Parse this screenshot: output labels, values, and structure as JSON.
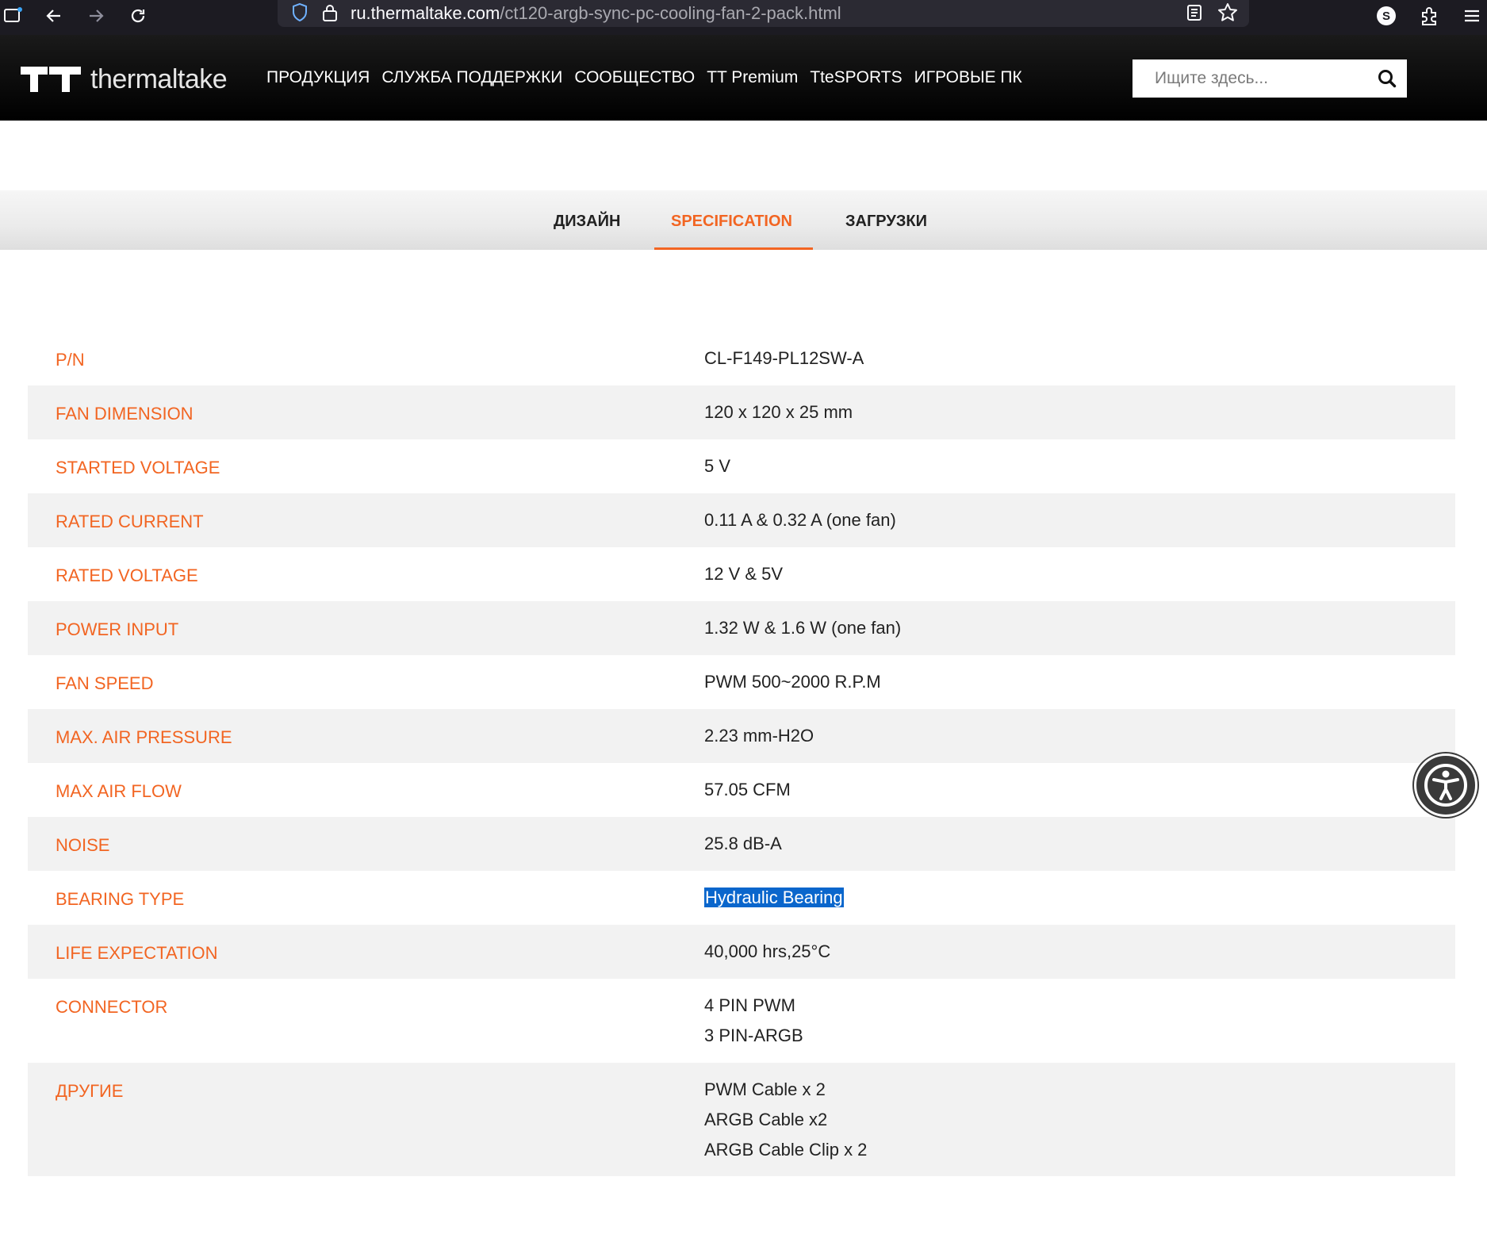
{
  "browser": {
    "url_domain": "ru.thermaltake.com",
    "url_path": "/ct120-argb-sync-pc-cooling-fan-2-pack.html",
    "profile_initial": "S"
  },
  "header": {
    "logo_text": "thermaltake",
    "nav": [
      "ПРОДУКЦИЯ",
      "СЛУЖБА ПОДДЕРЖКИ",
      "СООБЩЕСТВО",
      "TT Premium",
      "TteSPORTS",
      "ИГРОВЫЕ ПК"
    ],
    "search_placeholder": "Ищите здесь..."
  },
  "tabs": {
    "items": [
      "ДИЗАЙН",
      "SPECIFICATION",
      "ЗАГРУЗКИ"
    ],
    "active": "SPECIFICATION"
  },
  "specs": [
    {
      "label": "P/N",
      "values": [
        "CL-F149-PL12SW-A"
      ]
    },
    {
      "label": "FAN DIMENSION",
      "values": [
        "120 x 120 x 25 mm"
      ]
    },
    {
      "label": "STARTED VOLTAGE",
      "values": [
        "5 V"
      ]
    },
    {
      "label": "RATED CURRENT",
      "values": [
        "0.11 A & 0.32 A (one fan)"
      ]
    },
    {
      "label": "RATED VOLTAGE",
      "values": [
        "12 V & 5V"
      ]
    },
    {
      "label": "POWER INPUT",
      "values": [
        "1.32 W & 1.6 W (one fan)"
      ]
    },
    {
      "label": "FAN SPEED",
      "values": [
        "PWM 500~2000 R.P.M"
      ]
    },
    {
      "label": "MAX. AIR PRESSURE",
      "values": [
        "2.23 mm-H2O"
      ]
    },
    {
      "label": "MAX AIR FLOW",
      "values": [
        "57.05 CFM"
      ]
    },
    {
      "label": "NOISE",
      "values": [
        "25.8 dB-A"
      ]
    },
    {
      "label": "BEARING TYPE",
      "values": [
        "Hydraulic Bearing"
      ]
    },
    {
      "label": "LIFE EXPECTATION",
      "values": [
        "40,000 hrs,25°C"
      ]
    },
    {
      "label": "CONNECTOR",
      "values": [
        "4 PIN PWM",
        "3 PIN-ARGB"
      ]
    },
    {
      "label": "ДРУГИЕ",
      "values": [
        "PWM Cable x 2",
        "ARGB Cable x2",
        "ARGB Cable Clip x 2"
      ]
    }
  ],
  "colors": {
    "accent": "#f26522",
    "selection": "#0a66cc"
  }
}
